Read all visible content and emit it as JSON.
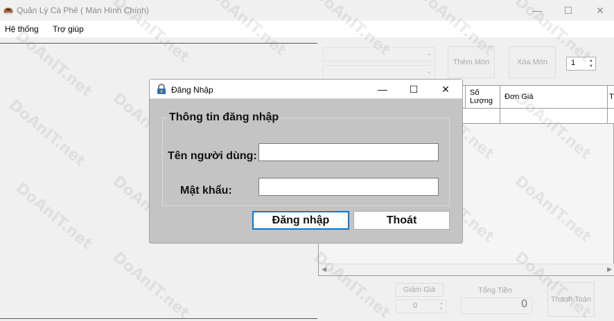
{
  "window": {
    "title": "Quản Lý Cà Phê ( Màn Hình Chính)",
    "minimize": "—",
    "maximize": "☐",
    "close": "✕"
  },
  "menu": {
    "items": [
      "Hệ thống",
      "Trợ giúp"
    ]
  },
  "order_panel": {
    "add_button": "Thêm Món",
    "remove_button": "Xóa Món",
    "quantity_value": "1",
    "columns": [
      "Số Lượng",
      "Đơn Giá",
      "T"
    ],
    "discount_label": "Giảm Giá",
    "discount_value": "0",
    "total_label": "Tổng Tiền",
    "total_value": "0",
    "pay_button": "Thanh Toán"
  },
  "login_dialog": {
    "title": "Đăng Nhập",
    "minimize": "—",
    "maximize": "☐",
    "close": "✕",
    "group_title": "Thông tin đăng nhập",
    "username_label": "Tên người dùng:",
    "username_value": "",
    "password_label": "Mật khẩu:",
    "password_value": "",
    "login_button": "Đăng nhập",
    "exit_button": "Thoát"
  },
  "watermark": "DoAnIT.net"
}
